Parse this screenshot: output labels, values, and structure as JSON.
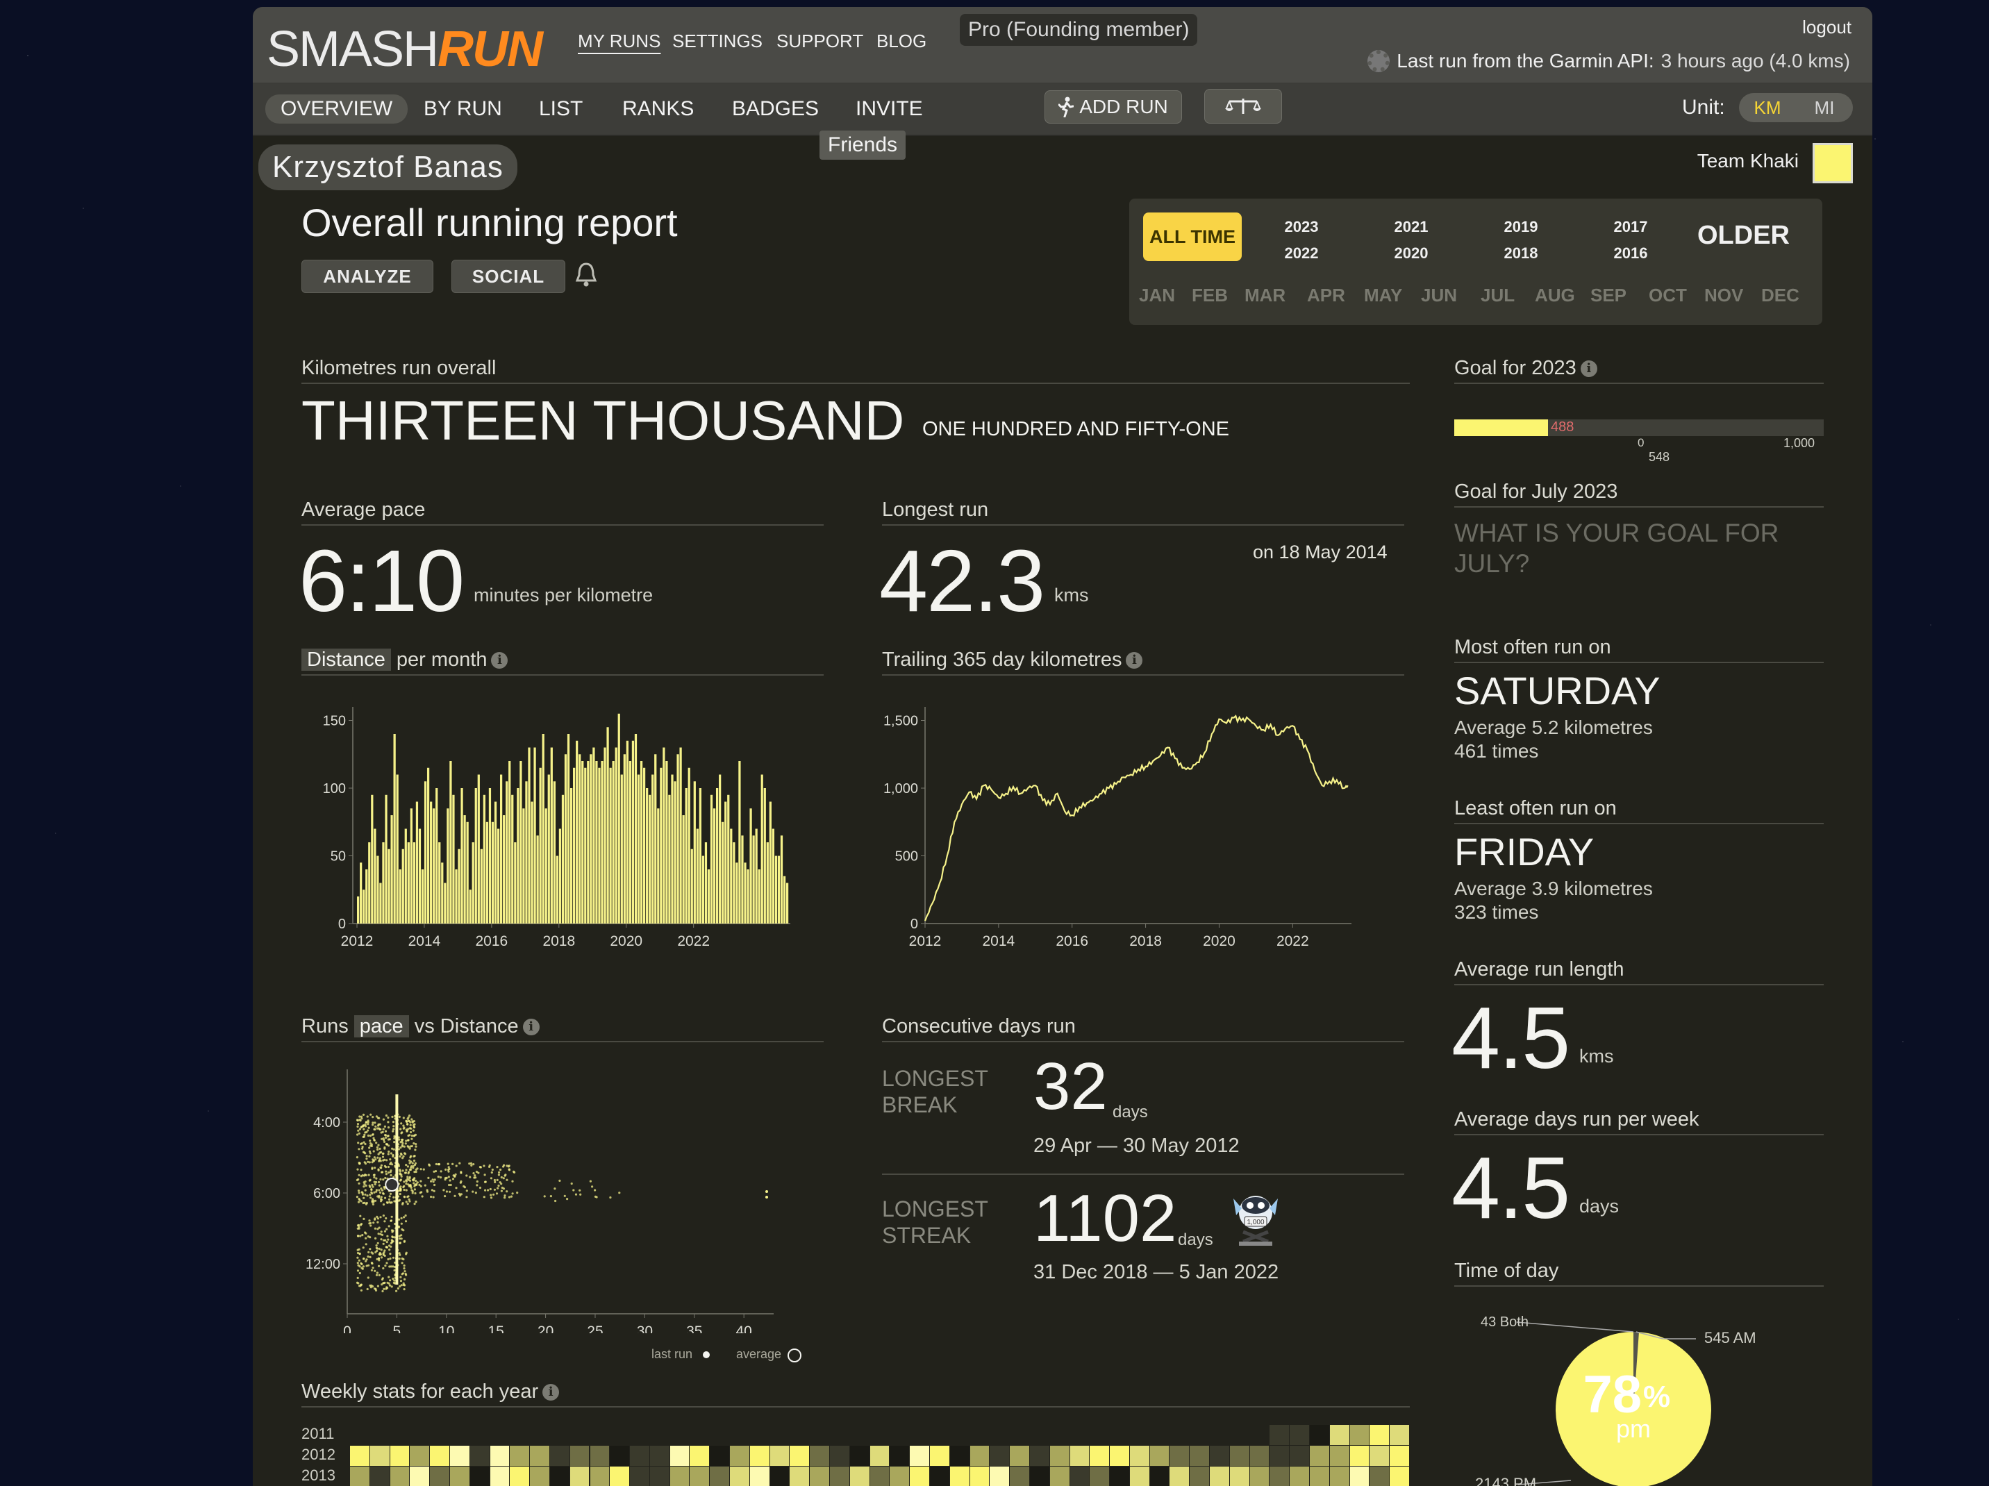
{
  "header": {
    "logo_smash": "SMASH",
    "logo_run": "RUN",
    "nav": [
      "MY RUNS",
      "SETTINGS",
      "SUPPORT",
      "BLOG"
    ],
    "pro_badge": "Pro (Founding member)",
    "logout": "logout",
    "garmin_label": "Last run from the Garmin API:",
    "garmin_value": "3 hours ago (4.0 kms)"
  },
  "subnav": {
    "items": [
      "OVERVIEW",
      "BY RUN",
      "LIST",
      "RANKS",
      "BADGES",
      "INVITE"
    ],
    "add_run": "ADD RUN",
    "unit_label": "Unit:",
    "unit_km": "KM",
    "unit_mi": "MI",
    "friends_tooltip": "Friends"
  },
  "profile": {
    "name": "Krzysztof Banas",
    "team": "Team Khaki",
    "team_color": "#fbf571"
  },
  "report": {
    "title": "Overall running report",
    "analyze": "ANALYZE",
    "social": "SOCIAL"
  },
  "date_picker": {
    "all_time": "ALL TIME",
    "years": [
      [
        "2023",
        "2022"
      ],
      [
        "2021",
        "2020"
      ],
      [
        "2019",
        "2018"
      ],
      [
        "2017",
        "2016"
      ]
    ],
    "older": "OLDER",
    "months": [
      "JAN",
      "FEB",
      "MAR",
      "APR",
      "MAY",
      "JUN",
      "JUL",
      "AUG",
      "SEP",
      "OCT",
      "NOV",
      "DEC"
    ]
  },
  "km_overall": {
    "label": "Kilometres run overall",
    "big": "THIRTEEN THOUSAND",
    "small": "ONE HUNDRED AND FIFTY-ONE"
  },
  "avg_pace": {
    "label": "Average pace",
    "value": "6:10",
    "unit": "minutes per kilometre"
  },
  "longest_run": {
    "label": "Longest run",
    "value": "42.3",
    "unit": "kms",
    "date": "on 18 May 2014"
  },
  "goal_year": {
    "label": "Goal for 2023",
    "progress_value": 488,
    "marker_0": "0",
    "marker_548": "548",
    "max": "1,000",
    "progress_label": "488"
  },
  "goal_month": {
    "label": "Goal for July 2023",
    "placeholder": "WHAT IS YOUR GOAL FOR JULY?"
  },
  "most_often": {
    "label": "Most often run on",
    "day": "SATURDAY",
    "avg": "Average 5.2 kilometres",
    "times": "461 times"
  },
  "least_often": {
    "label": "Least often run on",
    "day": "FRIDAY",
    "avg": "Average 3.9 kilometres",
    "times": "323 times"
  },
  "avg_run_length": {
    "label": "Average run length",
    "value": "4.5",
    "unit": "kms"
  },
  "avg_days_week": {
    "label": "Average days run per week",
    "value": "4.5",
    "unit": "days"
  },
  "time_of_day": {
    "label": "Time of day",
    "pct": "78",
    "pct_sign": "%",
    "pm": "pm",
    "both": "43 Both",
    "am": "545 AM",
    "pm_count": "2143 PM"
  },
  "distance_chart_title": {
    "hl": "Distance",
    "rest": "per month"
  },
  "trailing_title": "Trailing 365 day kilometres",
  "pace_chart_title": {
    "pre": "Runs",
    "hl": "pace",
    "post": "vs Distance"
  },
  "pace_legend": {
    "last_run": "last run",
    "average": "average"
  },
  "consecutive": {
    "label": "Consecutive days run",
    "break_label_1": "LONGEST",
    "break_label_2": "BREAK",
    "break_value": "32",
    "break_unit": "days",
    "break_dates": "29 Apr — 30 May 2012",
    "streak_label_1": "LONGEST",
    "streak_label_2": "STREAK",
    "streak_value": "1102",
    "streak_unit": "days",
    "streak_dates": "31 Dec 2018 — 5 Jan 2022",
    "badge_text": "1,000"
  },
  "weekly": {
    "label": "Weekly stats for each year",
    "years": [
      "2011",
      "2012",
      "2013"
    ]
  },
  "chart_data": [
    {
      "type": "bar",
      "title": "Distance per month",
      "x_ticks": [
        "2012",
        "2014",
        "2016",
        "2018",
        "2020",
        "2022"
      ],
      "y_ticks": [
        "0",
        "50",
        "100",
        "150"
      ],
      "ylim": [
        0,
        160
      ],
      "x_start": 2012.0,
      "values": [
        20,
        45,
        25,
        40,
        60,
        95,
        70,
        50,
        30,
        60,
        95,
        55,
        80,
        140,
        110,
        40,
        55,
        70,
        60,
        85,
        60,
        90,
        70,
        40,
        105,
        115,
        90,
        85,
        100,
        60,
        45,
        30,
        85,
        120,
        95,
        40,
        55,
        100,
        80,
        75,
        25,
        60,
        100,
        110,
        55,
        95,
        75,
        100,
        75,
        90,
        70,
        110,
        80,
        105,
        120,
        95,
        60,
        100,
        120,
        85,
        105,
        130,
        90,
        130,
        65,
        115,
        140,
        85,
        110,
        130,
        105,
        50,
        70,
        95,
        125,
        140,
        100,
        115,
        135,
        125,
        120,
        115,
        120,
        125,
        130,
        120,
        115,
        120,
        130,
        145,
        115,
        120,
        130,
        155,
        110,
        125,
        135,
        120,
        135,
        140,
        110,
        120,
        115,
        100,
        95,
        110,
        125,
        85,
        115,
        130,
        120,
        95,
        110,
        105,
        125,
        130,
        80,
        100,
        115,
        55,
        105,
        70,
        100,
        50,
        60,
        40,
        95,
        85,
        100,
        110,
        75,
        90,
        95,
        70,
        60,
        45,
        120,
        65,
        45,
        40,
        85,
        65,
        70,
        40,
        110,
        100,
        60,
        90,
        70,
        50,
        50,
        65,
        35,
        30
      ],
      "color": "#f6f28a"
    },
    {
      "type": "line",
      "title": "Trailing 365 day kilometres",
      "x_ticks": [
        "2012",
        "2014",
        "2016",
        "2018",
        "2020",
        "2022"
      ],
      "y_ticks": [
        "0",
        "500",
        "1,000",
        "1,500"
      ],
      "ylim": [
        0,
        1500
      ],
      "xlim": [
        2012.0,
        2023.6
      ],
      "points": [
        [
          2012.0,
          20
        ],
        [
          2012.2,
          150
        ],
        [
          2012.4,
          300
        ],
        [
          2012.6,
          500
        ],
        [
          2012.8,
          750
        ],
        [
          2013.0,
          880
        ],
        [
          2013.2,
          970
        ],
        [
          2013.4,
          920
        ],
        [
          2013.6,
          1020
        ],
        [
          2013.8,
          990
        ],
        [
          2014.0,
          930
        ],
        [
          2014.2,
          960
        ],
        [
          2014.4,
          1010
        ],
        [
          2014.6,
          960
        ],
        [
          2014.8,
          1000
        ],
        [
          2015.0,
          1020
        ],
        [
          2015.2,
          910
        ],
        [
          2015.4,
          880
        ],
        [
          2015.6,
          960
        ],
        [
          2015.8,
          830
        ],
        [
          2016.0,
          800
        ],
        [
          2016.2,
          860
        ],
        [
          2016.4,
          890
        ],
        [
          2016.6,
          920
        ],
        [
          2016.8,
          960
        ],
        [
          2017.0,
          1000
        ],
        [
          2017.2,
          1030
        ],
        [
          2017.4,
          1080
        ],
        [
          2017.6,
          1100
        ],
        [
          2017.8,
          1140
        ],
        [
          2018.0,
          1160
        ],
        [
          2018.2,
          1200
        ],
        [
          2018.4,
          1240
        ],
        [
          2018.6,
          1300
        ],
        [
          2018.8,
          1220
        ],
        [
          2019.0,
          1150
        ],
        [
          2019.2,
          1140
        ],
        [
          2019.4,
          1190
        ],
        [
          2019.6,
          1260
        ],
        [
          2019.8,
          1400
        ],
        [
          2020.0,
          1510
        ],
        [
          2020.2,
          1480
        ],
        [
          2020.4,
          1520
        ],
        [
          2020.6,
          1500
        ],
        [
          2020.8,
          1510
        ],
        [
          2021.0,
          1460
        ],
        [
          2021.2,
          1430
        ],
        [
          2021.4,
          1470
        ],
        [
          2021.6,
          1390
        ],
        [
          2021.8,
          1440
        ],
        [
          2022.0,
          1460
        ],
        [
          2022.2,
          1360
        ],
        [
          2022.4,
          1280
        ],
        [
          2022.6,
          1130
        ],
        [
          2022.8,
          1020
        ],
        [
          2023.0,
          1050
        ],
        [
          2023.2,
          1060
        ],
        [
          2023.4,
          1000
        ],
        [
          2023.5,
          1020
        ]
      ],
      "color": "#f6f28a"
    },
    {
      "type": "scatter",
      "title": "Runs pace vs Distance",
      "x_ticks": [
        "0",
        "5",
        "10",
        "15",
        "20",
        "25",
        "30",
        "35",
        "40"
      ],
      "y_ticks": [
        "4:00",
        "6:00",
        "12:00"
      ],
      "xlim": [
        0,
        43
      ],
      "series": [
        {
          "name": "runs"
        }
      ],
      "color": "#f6f28a"
    }
  ]
}
